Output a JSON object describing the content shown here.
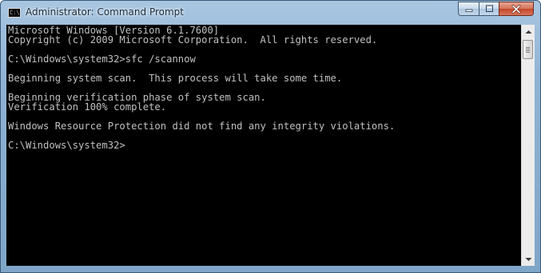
{
  "window": {
    "title": "Administrator: Command Prompt",
    "app_icon_text": "C:\\",
    "icon": "cmd-icon"
  },
  "caption_buttons": {
    "minimize_icon": "minimize-icon",
    "maximize_icon": "maximize-icon",
    "close_icon": "close-icon"
  },
  "console": {
    "lines": [
      "Microsoft Windows [Version 6.1.7600]",
      "Copyright (c) 2009 Microsoft Corporation.  All rights reserved.",
      "",
      "C:\\Windows\\system32>sfc /scannow",
      "",
      "Beginning system scan.  This process will take some time.",
      "",
      "Beginning verification phase of system scan.",
      "Verification 100% complete.",
      "",
      "Windows Resource Protection did not find any integrity violations.",
      "",
      "C:\\Windows\\system32>"
    ]
  },
  "colors": {
    "console_background": "#000000",
    "console_text": "#c0c0c0"
  },
  "scrollbar": {
    "up_icon": "scroll-up-arrow-icon",
    "down_icon": "scroll-down-arrow-icon"
  }
}
